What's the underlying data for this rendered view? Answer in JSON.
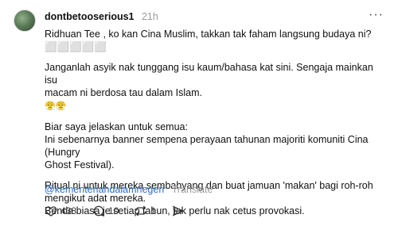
{
  "post": {
    "username": "dontbetooserious1",
    "time": "21h",
    "more": "···",
    "lines": {
      "l1": "Ridhuan Tee , ko kan Cina Muslim, takkan tak faham langsung budaya ni? ⬜⬜⬜⬜⬜",
      "l2": "Janganlah asyik nak tunggang isu kaum/bahasa kat sini. Sengaja mainkan isu",
      "l3": "macam ni berdosa tau dalam Islam.",
      "emoji": "😤😤",
      "l4": "Biar saya jelaskan untuk semua:",
      "l5": "Ini sebenarnya banner sempena perayaan tahunan majoriti komuniti Cina (Hungry",
      "l6": "Ghost Festival).",
      "l7": "Ritual ni untuk mereka sembahyang dan buat jamuan 'makan' bagi roh-roh",
      "l8": "mengikut adat mereka.",
      "l9": "Benda biasa je setiap tahun, tak perlu nak cetus provokasi."
    },
    "mention": "@kementeriandalamnegeri",
    "translate": "Translate"
  },
  "actions": {
    "likes": "438",
    "comments": "10",
    "reposts": "1"
  },
  "icons": [
    "heart-icon",
    "comment-icon",
    "repost-icon",
    "share-icon"
  ]
}
